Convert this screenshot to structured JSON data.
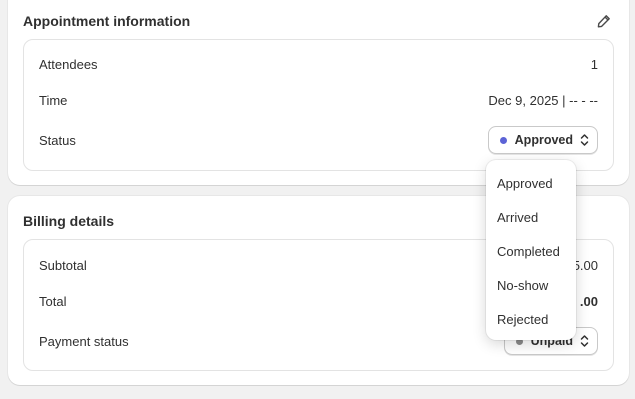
{
  "appointment": {
    "title": "Appointment information",
    "rows": [
      {
        "label": "Attendees",
        "value": "1"
      },
      {
        "label": "Time",
        "value": "Dec 9, 2025 | -- - --"
      },
      {
        "label": "Status",
        "value": "Approved"
      }
    ],
    "status_dot_color": "#5c63d6",
    "edit_icon": "pencil-icon"
  },
  "billing": {
    "title": "Billing details",
    "rows": [
      {
        "label": "Subtotal",
        "value": "5.00"
      },
      {
        "label": "Total",
        "value": ".00"
      },
      {
        "label": "Payment status",
        "value": "Unpaid"
      }
    ],
    "payment_dot_color": "#8a8a8a"
  },
  "status_dropdown": {
    "options": [
      "Approved",
      "Arrived",
      "Completed",
      "No-show",
      "Rejected"
    ]
  }
}
